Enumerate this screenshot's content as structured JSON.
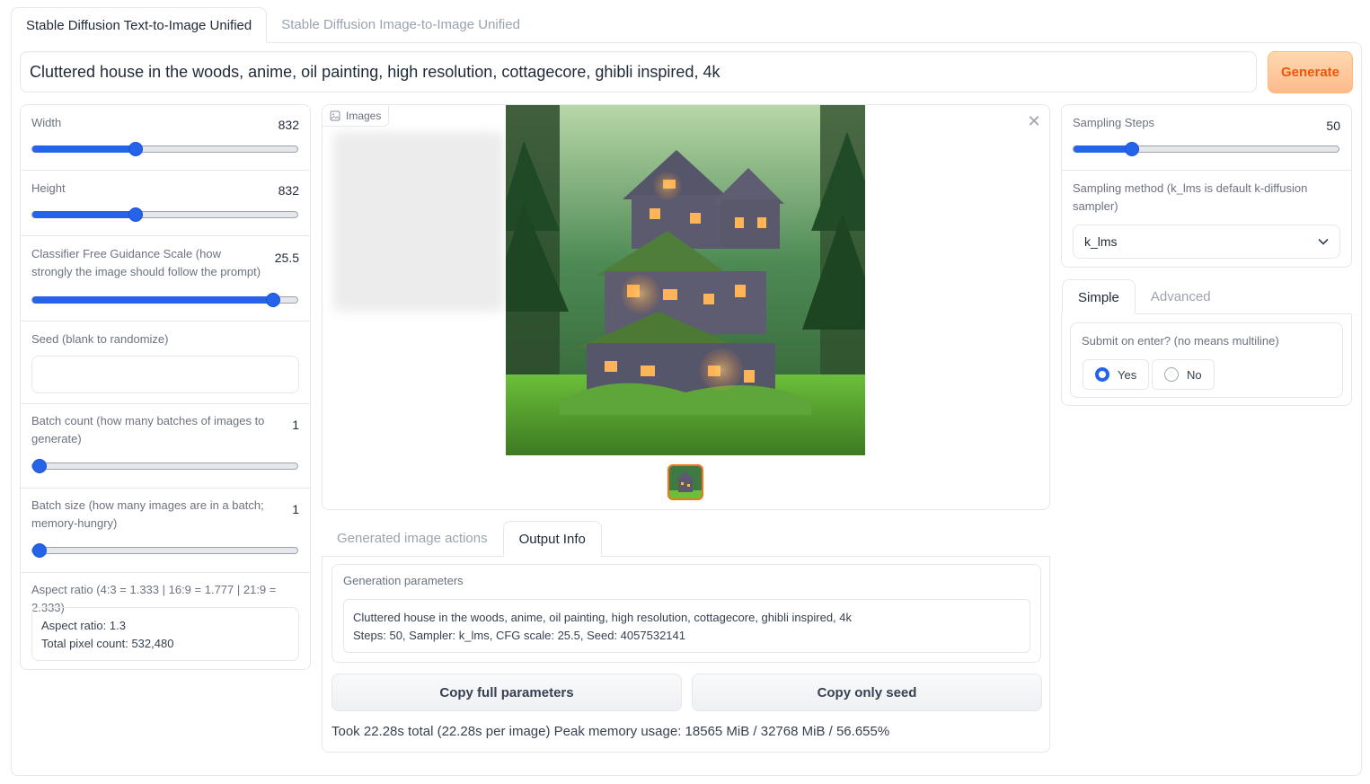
{
  "tabs": [
    {
      "label": "Stable Diffusion Text-to-Image Unified",
      "active": true
    },
    {
      "label": "Stable Diffusion Image-to-Image Unified",
      "active": false
    }
  ],
  "prompt": "Cluttered house in the woods, anime, oil painting, high resolution, cottagecore, ghibli inspired, 4k",
  "generate_label": "Generate",
  "left": {
    "width": {
      "label": "Width",
      "value": "832",
      "fraction": 0.39
    },
    "height": {
      "label": "Height",
      "value": "832",
      "fraction": 0.39
    },
    "cfg": {
      "label": "Classifier Free Guidance Scale (how strongly the image should follow the prompt)",
      "value": "25.5",
      "fraction": 0.91
    },
    "seed": {
      "label": "Seed (blank to randomize)",
      "value": ""
    },
    "batch_count": {
      "label": "Batch count (how many batches of images to generate)",
      "value": "1",
      "fraction": 0.0
    },
    "batch_size": {
      "label": "Batch size (how many images are in a batch; memory-hungry)",
      "value": "1",
      "fraction": 0.0
    },
    "aspect": {
      "label": "Aspect ratio (4:3 = 1.333 | 16:9 = 1.777 | 21:9 = 2.333)",
      "line1": "Aspect ratio: 1.3",
      "line2": "Total pixel count: 532,480"
    }
  },
  "gallery": {
    "label": "Images",
    "close_icon": "close-icon",
    "image_icon": "image-icon"
  },
  "output_tabs": [
    {
      "label": "Generated image actions",
      "active": false
    },
    {
      "label": "Output Info",
      "active": true
    }
  ],
  "output": {
    "params_label": "Generation parameters",
    "params_line1": "Cluttered house in the woods, anime, oil painting, high resolution, cottagecore, ghibli inspired, 4k",
    "params_line2": "Steps: 50, Sampler: k_lms, CFG scale: 25.5, Seed: 4057532141",
    "copy_full": "Copy full parameters",
    "copy_seed": "Copy only seed",
    "took": "Took 22.28s total (22.28s per image) Peak memory usage: 18565 MiB / 32768 MiB / 56.655%"
  },
  "right": {
    "steps": {
      "label": "Sampling Steps",
      "value": "50",
      "fraction": 0.22
    },
    "sampler_label": "Sampling method (k_lms is default k-diffusion sampler)",
    "sampler_value": "k_lms",
    "mode_tabs": [
      {
        "label": "Simple",
        "active": true
      },
      {
        "label": "Advanced",
        "active": false
      }
    ],
    "submit_label": "Submit on enter? (no means multiline)",
    "options": [
      {
        "label": "Yes",
        "selected": true
      },
      {
        "label": "No",
        "selected": false
      }
    ]
  },
  "colors": {
    "accent": "#2563eb",
    "generate": "#ea580c",
    "border": "#e5e7eb"
  }
}
